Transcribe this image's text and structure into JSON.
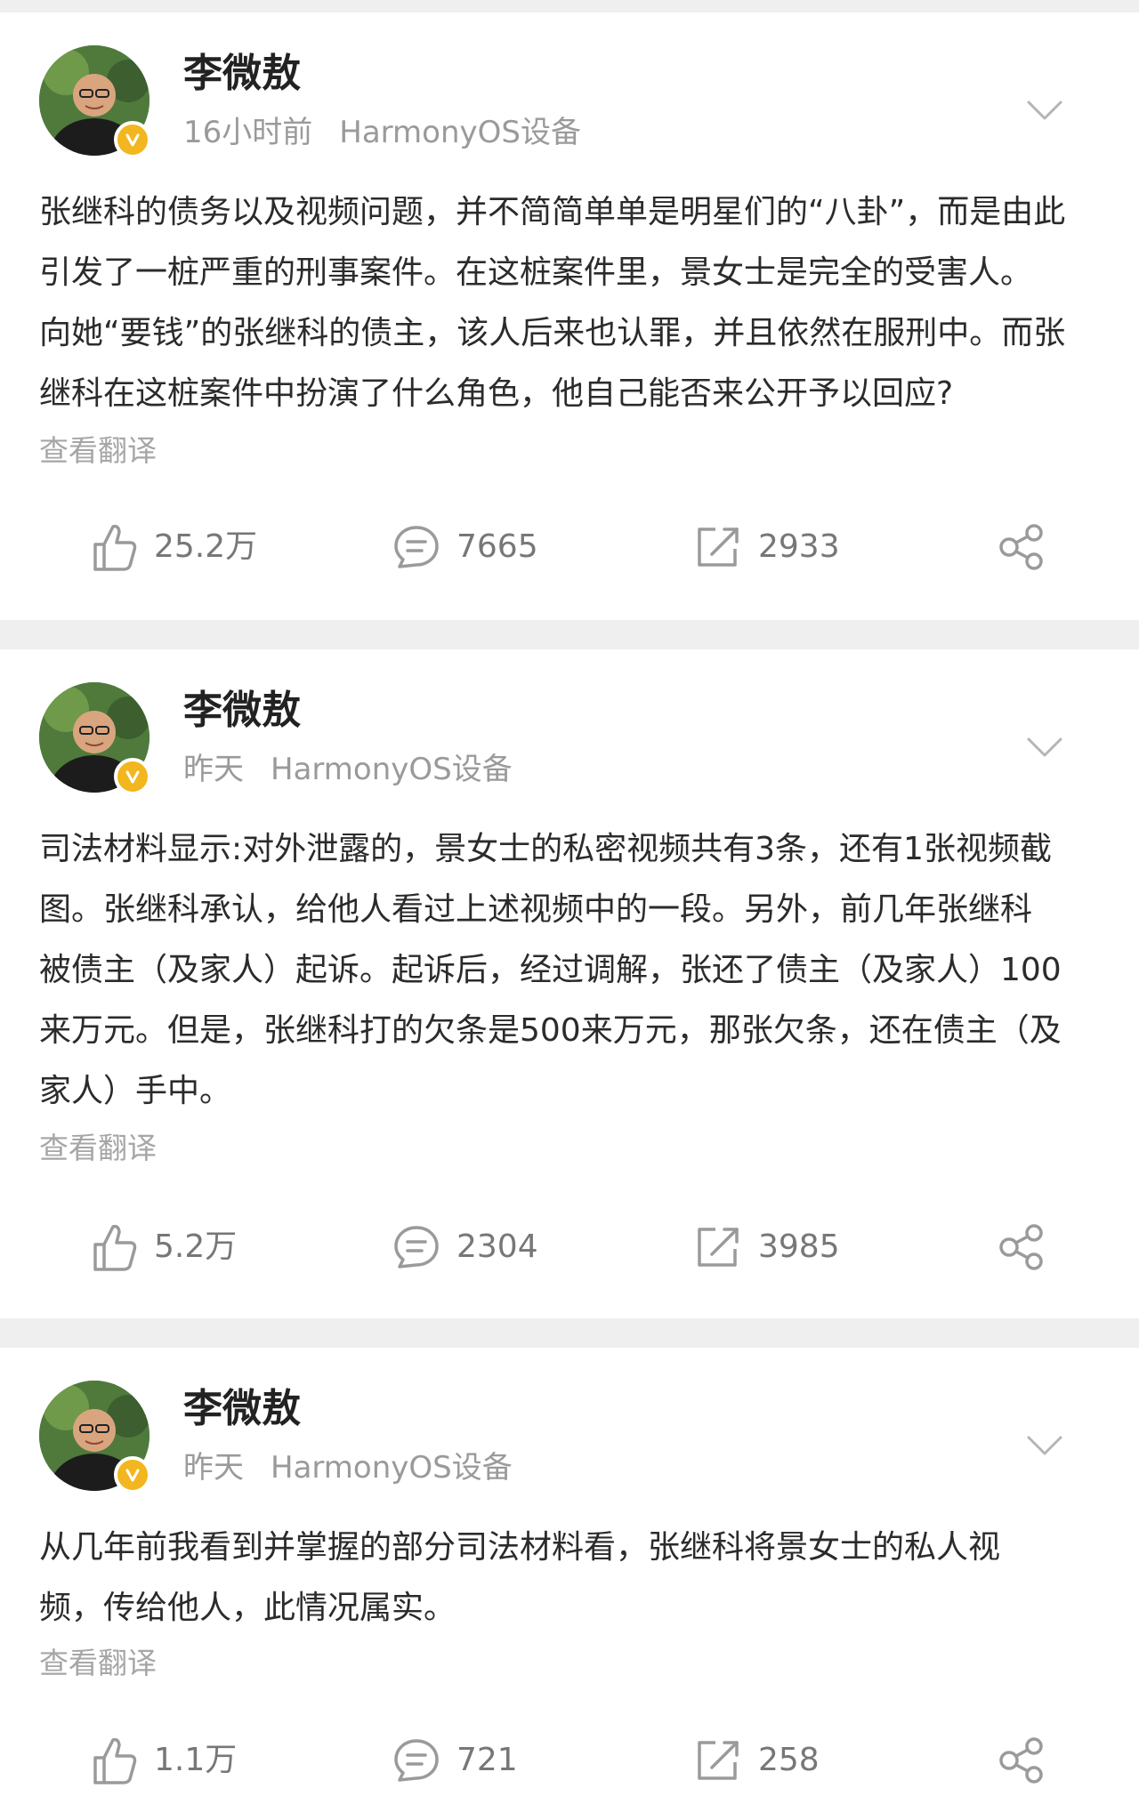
{
  "colors": {
    "background": "#efefef",
    "card": "#ffffff",
    "username": "#222222",
    "meta": "#9a9a9a",
    "content": "#2b2b2b",
    "translate": "#a6a6a6",
    "action": "#777777",
    "verify_badge": "#f2b61f"
  },
  "posts": [
    {
      "author": "李微敖",
      "time": "16小时前",
      "source": "HarmonyOS设备",
      "content": "张继科的债务以及视频问题，并不简简单单是明星们的“八卦”，而是由此\n引发了一桩严重的刑事案件。在这桩案件里，景女士是完全的受害人。\n向她“要钱”的张继科的债主，该人后来也认罪，并且依然在服刑中。而张\n继科在这桩案件中扮演了什么角色，他自己能否来公开予以回应?",
      "translate": "查看翻译",
      "likes": "25.2万",
      "comments": "7665",
      "reposts": "2933"
    },
    {
      "author": "李微敖",
      "time": "昨天",
      "source": "HarmonyOS设备",
      "content": "司法材料显示:对外泄露的，景女士的私密视频共有3条，还有1张视频截\n图。张继科承认，给他人看过上述视频中的一段。另外，前几年张继科\n被债主（及家人）起诉。起诉后，经过调解，张还了债主（及家人）100\n来万元。但是，张继科打的欠条是500来万元，那张欠条，还在债主（及\n家人）手中。",
      "translate": "查看翻译",
      "likes": "5.2万",
      "comments": "2304",
      "reposts": "3985"
    },
    {
      "author": "李微敖",
      "time": "昨天",
      "source": "HarmonyOS设备",
      "content": "从几年前我看到并掌握的部分司法材料看，张继科将景女士的私人视\n频，传给他人，此情况属实。",
      "translate": "查看翻译",
      "likes": "1.1万",
      "comments": "721",
      "reposts": "258"
    }
  ]
}
